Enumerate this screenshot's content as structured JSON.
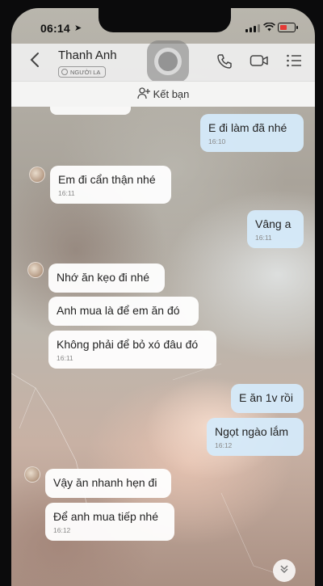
{
  "status": {
    "time": "06:14"
  },
  "header": {
    "contact_name": "Thanh Anh",
    "badge": "NGƯỜI LẠ"
  },
  "add_friend": {
    "label": "Kết bạn"
  },
  "messages": [
    {
      "dir": "out",
      "text": "E đi làm đã nhé",
      "time": "16:10"
    },
    {
      "dir": "in",
      "text": "Em đi cẩn thận nhé",
      "time": "16:11"
    },
    {
      "dir": "out",
      "text": "Vâng a",
      "time": "16:11"
    },
    {
      "dir": "in",
      "text": "Nhớ ăn kẹo đi nhé",
      "time": ""
    },
    {
      "dir": "in",
      "text": "Anh mua là để em ăn đó",
      "time": ""
    },
    {
      "dir": "in",
      "text": "Không phải để bỏ xó đâu đó",
      "time": "16:11"
    },
    {
      "dir": "out",
      "text": "E ăn 1v rồi",
      "time": ""
    },
    {
      "dir": "out",
      "text": "Ngọt ngào lắm",
      "time": "16:12"
    },
    {
      "dir": "in",
      "text": "Vậy ăn nhanh hẹn đi",
      "time": ""
    },
    {
      "dir": "in",
      "text": "Để anh mua tiếp nhé",
      "time": "16:12"
    }
  ],
  "icons": {
    "back": "chevron-left-icon",
    "call": "phone-icon",
    "video": "video-icon",
    "menu": "menu-icon",
    "add_friend": "add-user-icon",
    "scroll": "chevron-down-icon"
  },
  "colors": {
    "outgoing_bubble": "#d5eafa",
    "incoming_bubble": "#ffffff",
    "header": "#eeeeee"
  }
}
